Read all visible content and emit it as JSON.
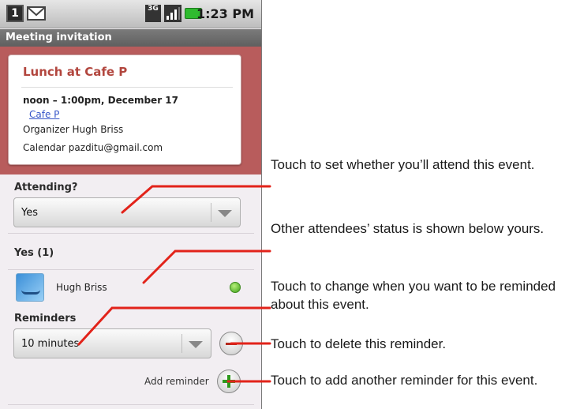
{
  "status_bar": {
    "time": "1:23 PM",
    "cal_glyph": "1",
    "net": "3G"
  },
  "header": {
    "title": "Meeting invitation"
  },
  "event": {
    "title": "Lunch at Cafe P",
    "when": "noon – 1:00pm, December 17",
    "where": "Cafe P",
    "organizer_label": "Organizer",
    "organizer": "Hugh Briss",
    "calendar_label": "Calendar",
    "calendar": "pazditu@gmail.com"
  },
  "attending": {
    "label": "Attending?",
    "value": "Yes"
  },
  "attendees": {
    "group_label": "Yes (1)",
    "items": [
      {
        "name": "Hugh Briss",
        "status_color": "#3ea01a"
      }
    ]
  },
  "reminders": {
    "label": "Reminders",
    "value": "10 minutes",
    "add_label": "Add reminder"
  },
  "callouts": {
    "attend": "Touch to set whether you’ll attend this event.",
    "others": "Other attendees’ status is shown below yours.",
    "change": "Touch to change when you want to be reminded about this event.",
    "delete": "Touch to delete this reminder.",
    "add": "Touch to add another reminder for this event."
  },
  "colors": {
    "event_band": "#b85c5c",
    "title_red": "#b2463e",
    "callout_line": "#e2231a"
  }
}
